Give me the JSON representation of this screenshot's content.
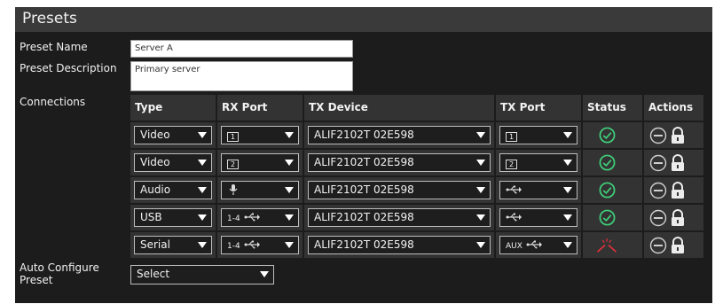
{
  "header": {
    "title": "Presets"
  },
  "form": {
    "preset_name_label": "Preset Name",
    "preset_name_value": "Server A",
    "preset_description_label": "Preset Description",
    "preset_description_value": "Primary server",
    "connections_label": "Connections",
    "auto_configure_label_line1": "Auto Configure",
    "auto_configure_label_line2": "Preset",
    "auto_configure_value": "Select"
  },
  "table": {
    "columns": [
      "Type",
      "RX Port",
      "TX Device",
      "TX Port",
      "Status",
      "Actions"
    ],
    "rows": [
      {
        "type": "Video",
        "rx_icon": "monitor-1-icon",
        "rx_text": "1",
        "tx_device": "ALIF2102T 02E598",
        "tx_icon": "monitor-1-icon",
        "tx_text": "1",
        "status": "ok"
      },
      {
        "type": "Video",
        "rx_icon": "monitor-2-icon",
        "rx_text": "2",
        "tx_device": "ALIF2102T 02E598",
        "tx_icon": "monitor-2-icon",
        "tx_text": "2",
        "status": "ok"
      },
      {
        "type": "Audio",
        "rx_icon": "microphone-icon",
        "rx_text": "",
        "tx_device": "ALIF2102T 02E598",
        "tx_icon": "usb-icon",
        "tx_text": "",
        "status": "ok"
      },
      {
        "type": "USB",
        "rx_icon": "usb-icon",
        "rx_text": "1-4",
        "tx_device": "ALIF2102T 02E598",
        "tx_icon": "usb-icon",
        "tx_text": "",
        "status": "ok"
      },
      {
        "type": "Serial",
        "rx_icon": "usb-icon",
        "rx_text": "1-4",
        "tx_device": "ALIF2102T 02E598",
        "tx_icon": "usb-icon",
        "tx_text": "AUX",
        "status": "error"
      }
    ]
  },
  "colors": {
    "ok": "#3fd17a",
    "error": "#e0303a",
    "panel": "#1c1c1c",
    "header": "#3a3a3a"
  }
}
